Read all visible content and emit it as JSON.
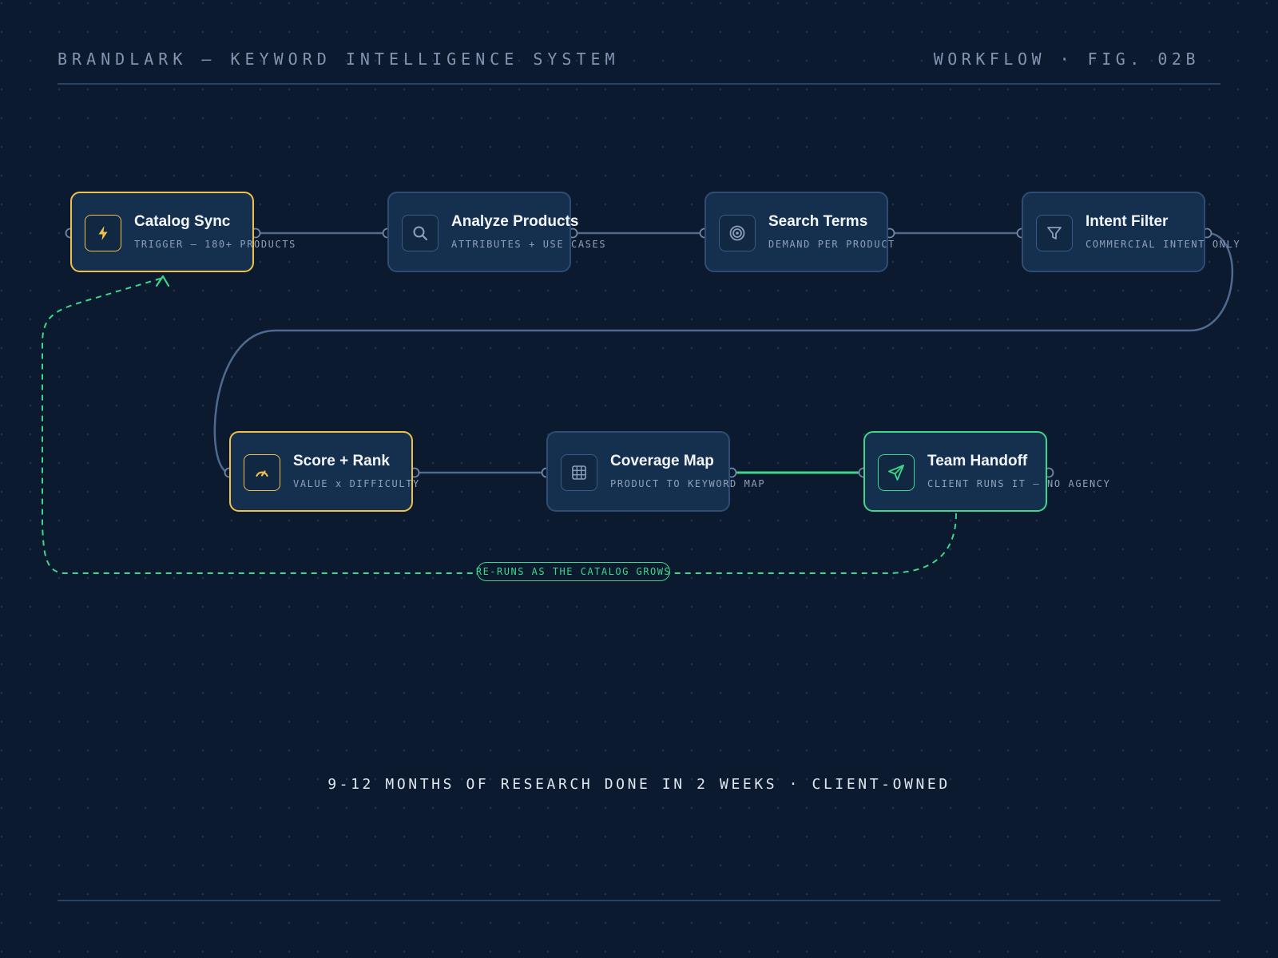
{
  "header": {
    "title": "BRANDLARK — KEYWORD INTELLIGENCE SYSTEM",
    "figure": "WORKFLOW · FIG. 02B"
  },
  "nodes": [
    {
      "id": "catalog-sync",
      "title": "Catalog Sync",
      "subtitle": "TRIGGER — 180+ PRODUCTS",
      "icon": "lightning-icon",
      "kind": "trigger"
    },
    {
      "id": "analyze-products",
      "title": "Analyze Products",
      "subtitle": "ATTRIBUTES + USE CASES",
      "icon": "search-icon",
      "kind": "step"
    },
    {
      "id": "search-terms",
      "title": "Search Terms",
      "subtitle": "DEMAND PER PRODUCT",
      "icon": "target-icon",
      "kind": "step"
    },
    {
      "id": "intent-filter",
      "title": "Intent Filter",
      "subtitle": "COMMERCIAL INTENT ONLY",
      "icon": "filter-icon",
      "kind": "step"
    },
    {
      "id": "score-rank",
      "title": "Score + Rank",
      "subtitle": "VALUE x DIFFICULTY",
      "icon": "gauge-icon",
      "kind": "trigger"
    },
    {
      "id": "coverage-map",
      "title": "Coverage Map",
      "subtitle": "PRODUCT TO KEYWORD MAP",
      "icon": "grid-icon",
      "kind": "step"
    },
    {
      "id": "team-handoff",
      "title": "Team Handoff",
      "subtitle": "CLIENT RUNS IT — NO AGENCY",
      "icon": "send-icon",
      "kind": "final"
    }
  ],
  "edges": [
    {
      "from": "catalog-sync",
      "to": "analyze-products",
      "style": "solid"
    },
    {
      "from": "analyze-products",
      "to": "search-terms",
      "style": "solid"
    },
    {
      "from": "search-terms",
      "to": "intent-filter",
      "style": "solid"
    },
    {
      "from": "intent-filter",
      "to": "score-rank",
      "style": "solid"
    },
    {
      "from": "score-rank",
      "to": "coverage-map",
      "style": "solid"
    },
    {
      "from": "coverage-map",
      "to": "team-handoff",
      "style": "highlight"
    },
    {
      "from": "team-handoff",
      "to": "catalog-sync",
      "style": "dashed-loop"
    }
  ],
  "loop_label": "RE-RUNS AS THE CATALOG GROWS",
  "tagline": "9-12 MONTHS OF RESEARCH DONE IN 2 WEEKS · CLIENT-OWNED",
  "colors": {
    "background": "#0b1a2e",
    "node_fill": "#15304f",
    "node_border": "#2f4d73",
    "trigger_accent": "#f0c04a",
    "final_accent": "#3dd68a",
    "wire": "#4e6a8e"
  }
}
